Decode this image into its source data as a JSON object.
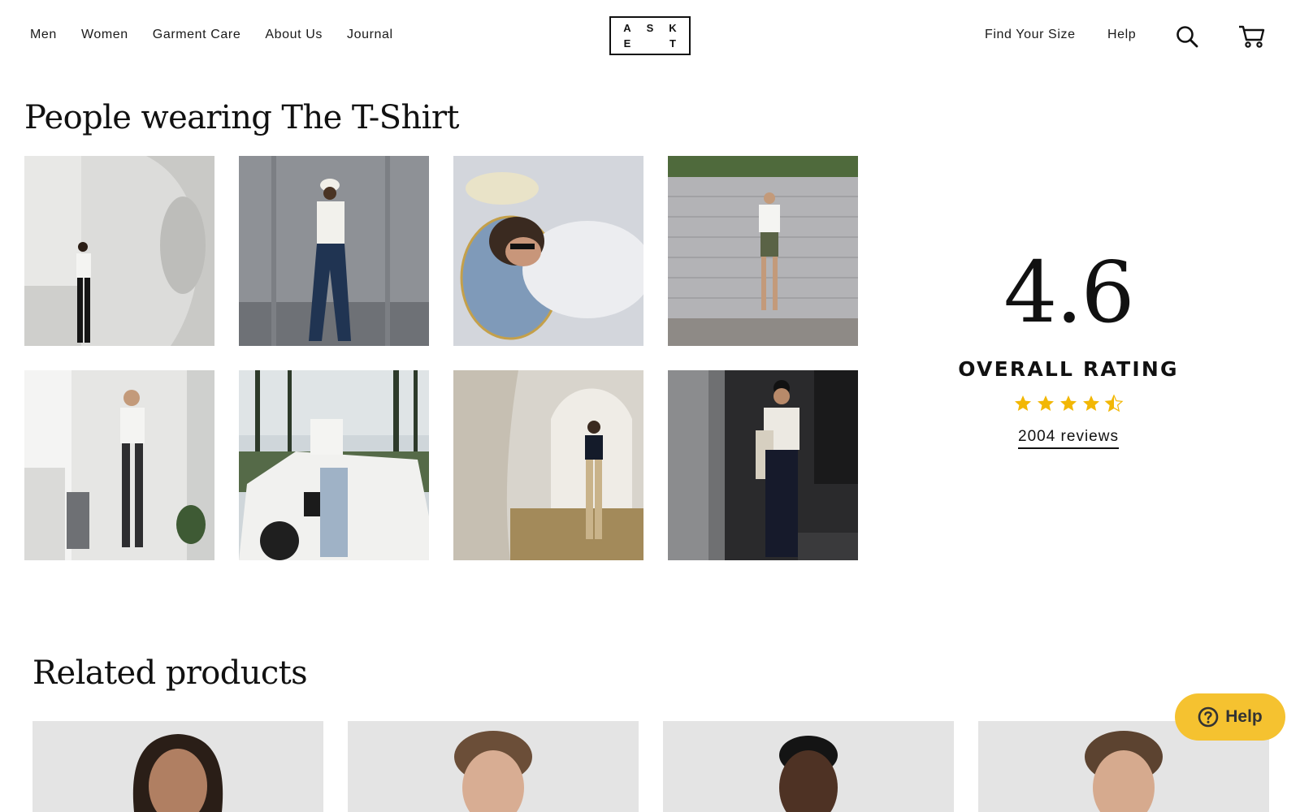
{
  "header": {
    "nav_left": [
      "Men",
      "Women",
      "Garment Care",
      "About Us",
      "Journal"
    ],
    "logo_letters": [
      "A",
      "S",
      "K",
      "E",
      "",
      "T"
    ],
    "find_size": "Find Your Size",
    "help": "Help",
    "search_icon": "search-icon",
    "cart_icon": "cart-icon"
  },
  "people": {
    "title": "People wearing The T-Shirt"
  },
  "rating": {
    "score": "4.6",
    "label": "OVERALL RATING",
    "stars": 4.5,
    "star_color": "#f2b705",
    "reviews": "2004 reviews"
  },
  "related": {
    "title": "Related products"
  },
  "help_widget": {
    "label": "Help",
    "icon": "question-circle-icon",
    "color": "#f5c230"
  }
}
